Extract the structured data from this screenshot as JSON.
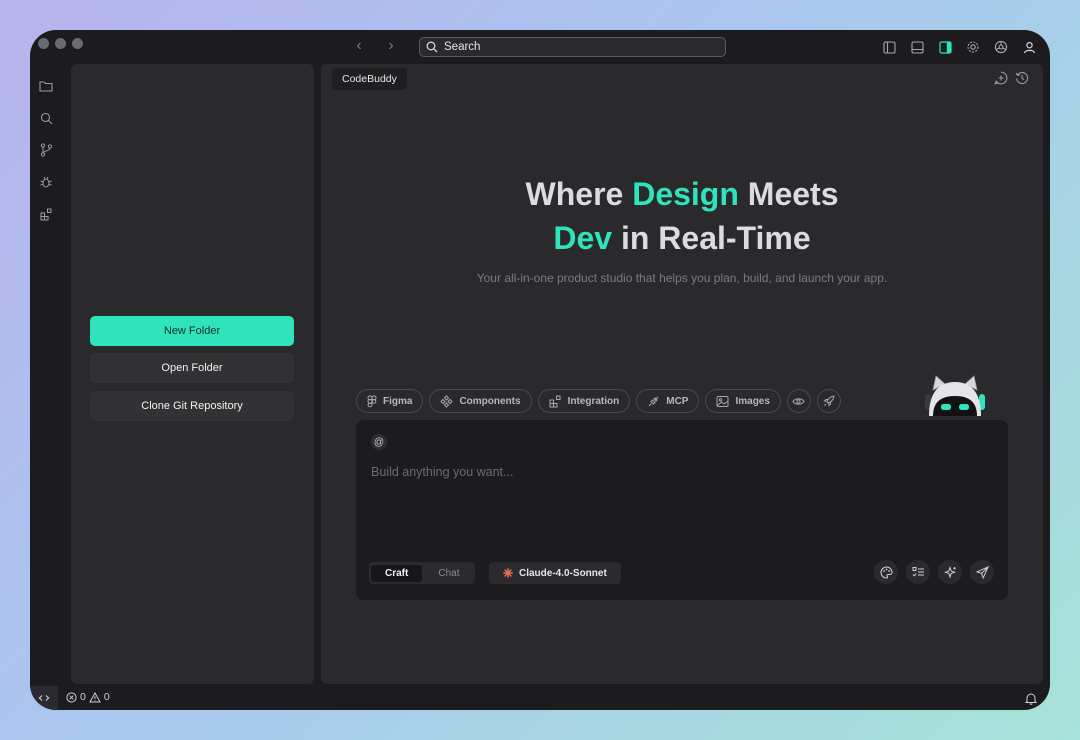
{
  "titlebar": {
    "back_label": "‹",
    "forward_label": "›",
    "search_placeholder": "Search"
  },
  "sidebar": {
    "buttons": [
      {
        "label": "New Folder"
      },
      {
        "label": "Open Folder"
      },
      {
        "label": "Clone Git Repository"
      }
    ]
  },
  "main": {
    "tab_label": "CodeBuddy",
    "hero": {
      "line1_prefix": "Where ",
      "line1_accent": "Design",
      "line1_suffix": " Meets",
      "line2_accent": "Dev",
      "line2_suffix": " in Real-Time"
    },
    "subtitle": "Your all-in-one product studio that helps you plan, build, and launch your app.",
    "chips": [
      {
        "label": "Figma",
        "icon": "figma-icon"
      },
      {
        "label": "Components",
        "icon": "components-icon"
      },
      {
        "label": "Integration",
        "icon": "integration-icon"
      },
      {
        "label": "MCP",
        "icon": "mcp-plug-icon"
      },
      {
        "label": "Images",
        "icon": "image-icon"
      }
    ],
    "input": {
      "at_label": "@",
      "placeholder": "Build anything you want..."
    },
    "mode": {
      "active": "Craft",
      "inactive": "Chat"
    },
    "model_label": "Claude-4.0-Sonnet"
  },
  "statusbar": {
    "errors": "0",
    "warnings": "0"
  },
  "colors": {
    "accent": "#2fe3bd",
    "window_bg": "#1c1c1f",
    "panel_bg": "#2a2a2d",
    "model_icon": "#e8744f"
  }
}
